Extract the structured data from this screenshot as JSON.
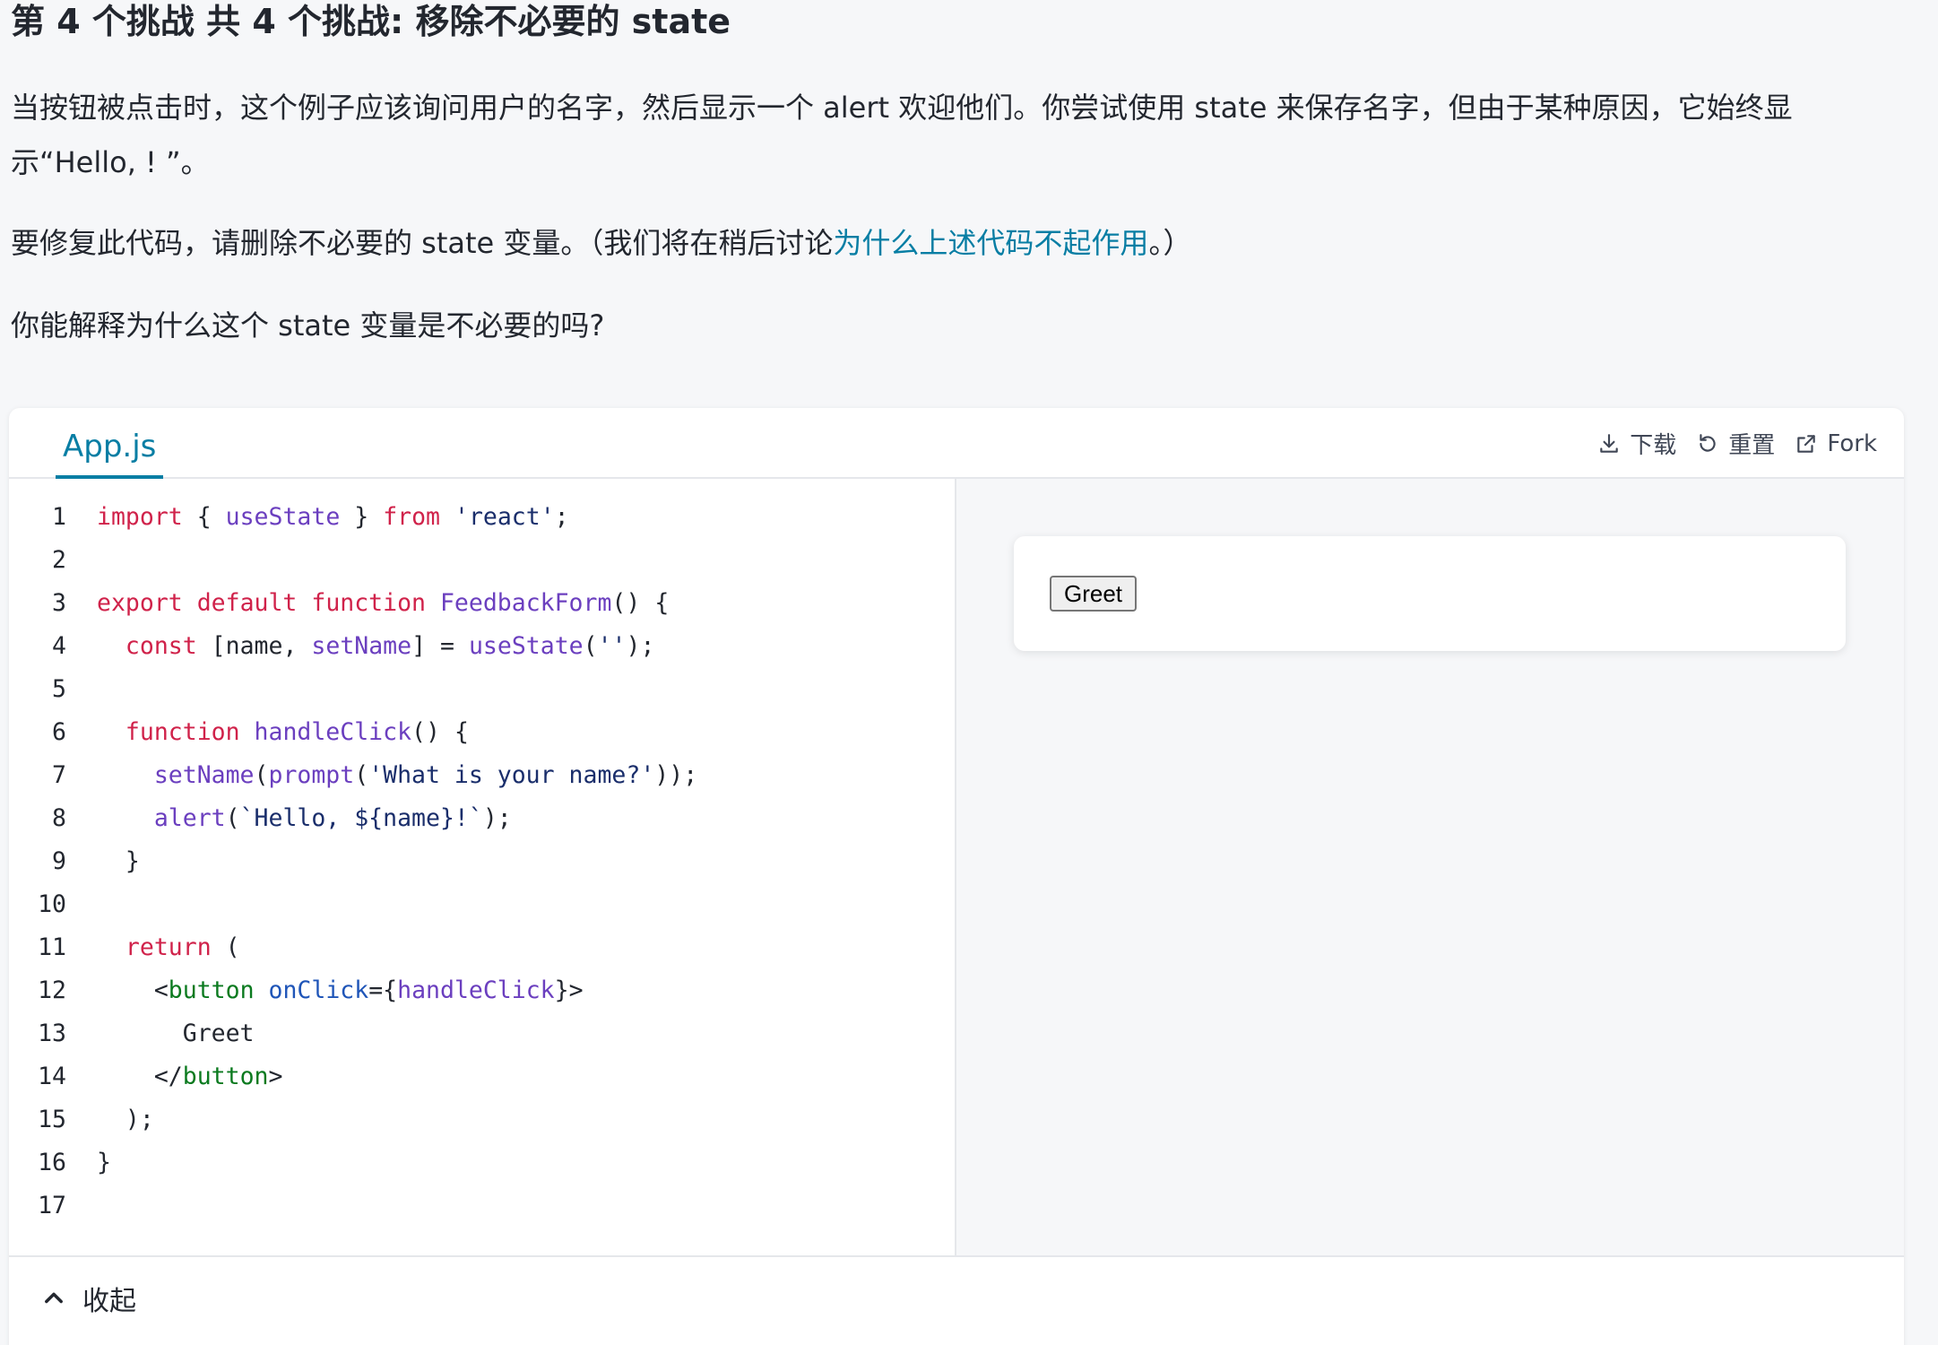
{
  "challenge": {
    "title": "第 4 个挑战 共 4 个挑战: 移除不必要的 state",
    "paragraph1": "当按钮被点击时，这个例子应该询问用户的名字，然后显示一个 alert 欢迎他们。你尝试使用 state 来保存名字，但由于某种原因，它始终显示“Hello, ! ”。",
    "paragraph2_before": "要修复此代码，请删除不必要的 state 变量。（我们将在稍后讨论",
    "paragraph2_link": "为什么上述代码不起作用",
    "paragraph2_after": "。）",
    "paragraph3": "你能解释为什么这个 state 变量是不必要的吗?"
  },
  "sandbox": {
    "tab_label": "App.js",
    "actions": {
      "download": "下载",
      "reset": "重置",
      "fork": "Fork"
    },
    "code_lines": [
      "import { useState } from 'react';",
      "",
      "export default function FeedbackForm() {",
      "  const [name, setName] = useState('');",
      "",
      "  function handleClick() {",
      "    setName(prompt('What is your name?'));",
      "    alert(`Hello, ${name}!`);",
      "  }",
      "",
      "  return (",
      "    <button onClick={handleClick}>",
      "      Greet",
      "    </button>",
      "  );",
      "}",
      ""
    ],
    "preview_button": "Greet",
    "collapse_label": "收起"
  },
  "colors": {
    "accent": "#087ea4",
    "keyword": "#d0224a",
    "function": "#6b3fbf",
    "string": "#1a2e6b",
    "jsx_tag": "#0b7a1f",
    "jsx_attr": "#1f55b8"
  },
  "icons": {
    "download": "download-icon",
    "reset": "reset-icon",
    "fork": "external-link-icon",
    "collapse": "chevron-up-icon"
  }
}
